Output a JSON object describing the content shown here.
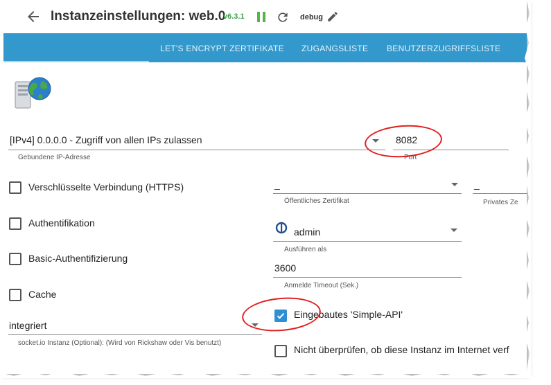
{
  "header": {
    "title": "Instanzeinstellungen: web.0",
    "version": "v6.3.1",
    "loglevel": "debug",
    "icons": [
      "back-arrow-icon",
      "pause-icon",
      "reload-icon",
      "edit-icon"
    ]
  },
  "tabs": [
    {
      "label": "LET'S ENCRYPT ZERTIFIKATE"
    },
    {
      "label": "ZUGANGSLISTE"
    },
    {
      "label": "BENUTZERZUGRIFFSLISTE"
    }
  ],
  "form": {
    "bind_value": "[IPv4] 0.0.0.0 - Zugriff von allen IPs zulassen",
    "bind_label": "Gebundene IP-Adresse",
    "port_value": "8082",
    "port_label": "Port",
    "https_label": "Verschlüsselte Verbindung (HTTPS)",
    "cert_public_value": "_",
    "cert_public_label": "Öffentliches Zertifikat",
    "cert_private_value": "_",
    "cert_private_label": "Privates Ze",
    "auth_label": "Authentifikation",
    "user_value": "admin",
    "user_label": "Ausführen als",
    "basic_auth_label": "Basic-Authentifizierung",
    "timeout_value": "3600",
    "timeout_label": "Anmelde Timeout (Sek.)",
    "cache_label": "Cache",
    "simple_api_label": "Eingebautes 'Simple-API'",
    "simple_api_checked": true,
    "socket_value": "integriert",
    "socket_label": "socket.io Instanz (Optional): (Wird von Rickshaw oder Vis benutzt)",
    "no_check_label": "Nicht überprüfen, ob diese Instanz im Internet verf"
  },
  "colors": {
    "tabbar": "#3399cc",
    "accent": "#2f8fd3",
    "annotation": "#e02020",
    "version": "#3fa34d"
  }
}
